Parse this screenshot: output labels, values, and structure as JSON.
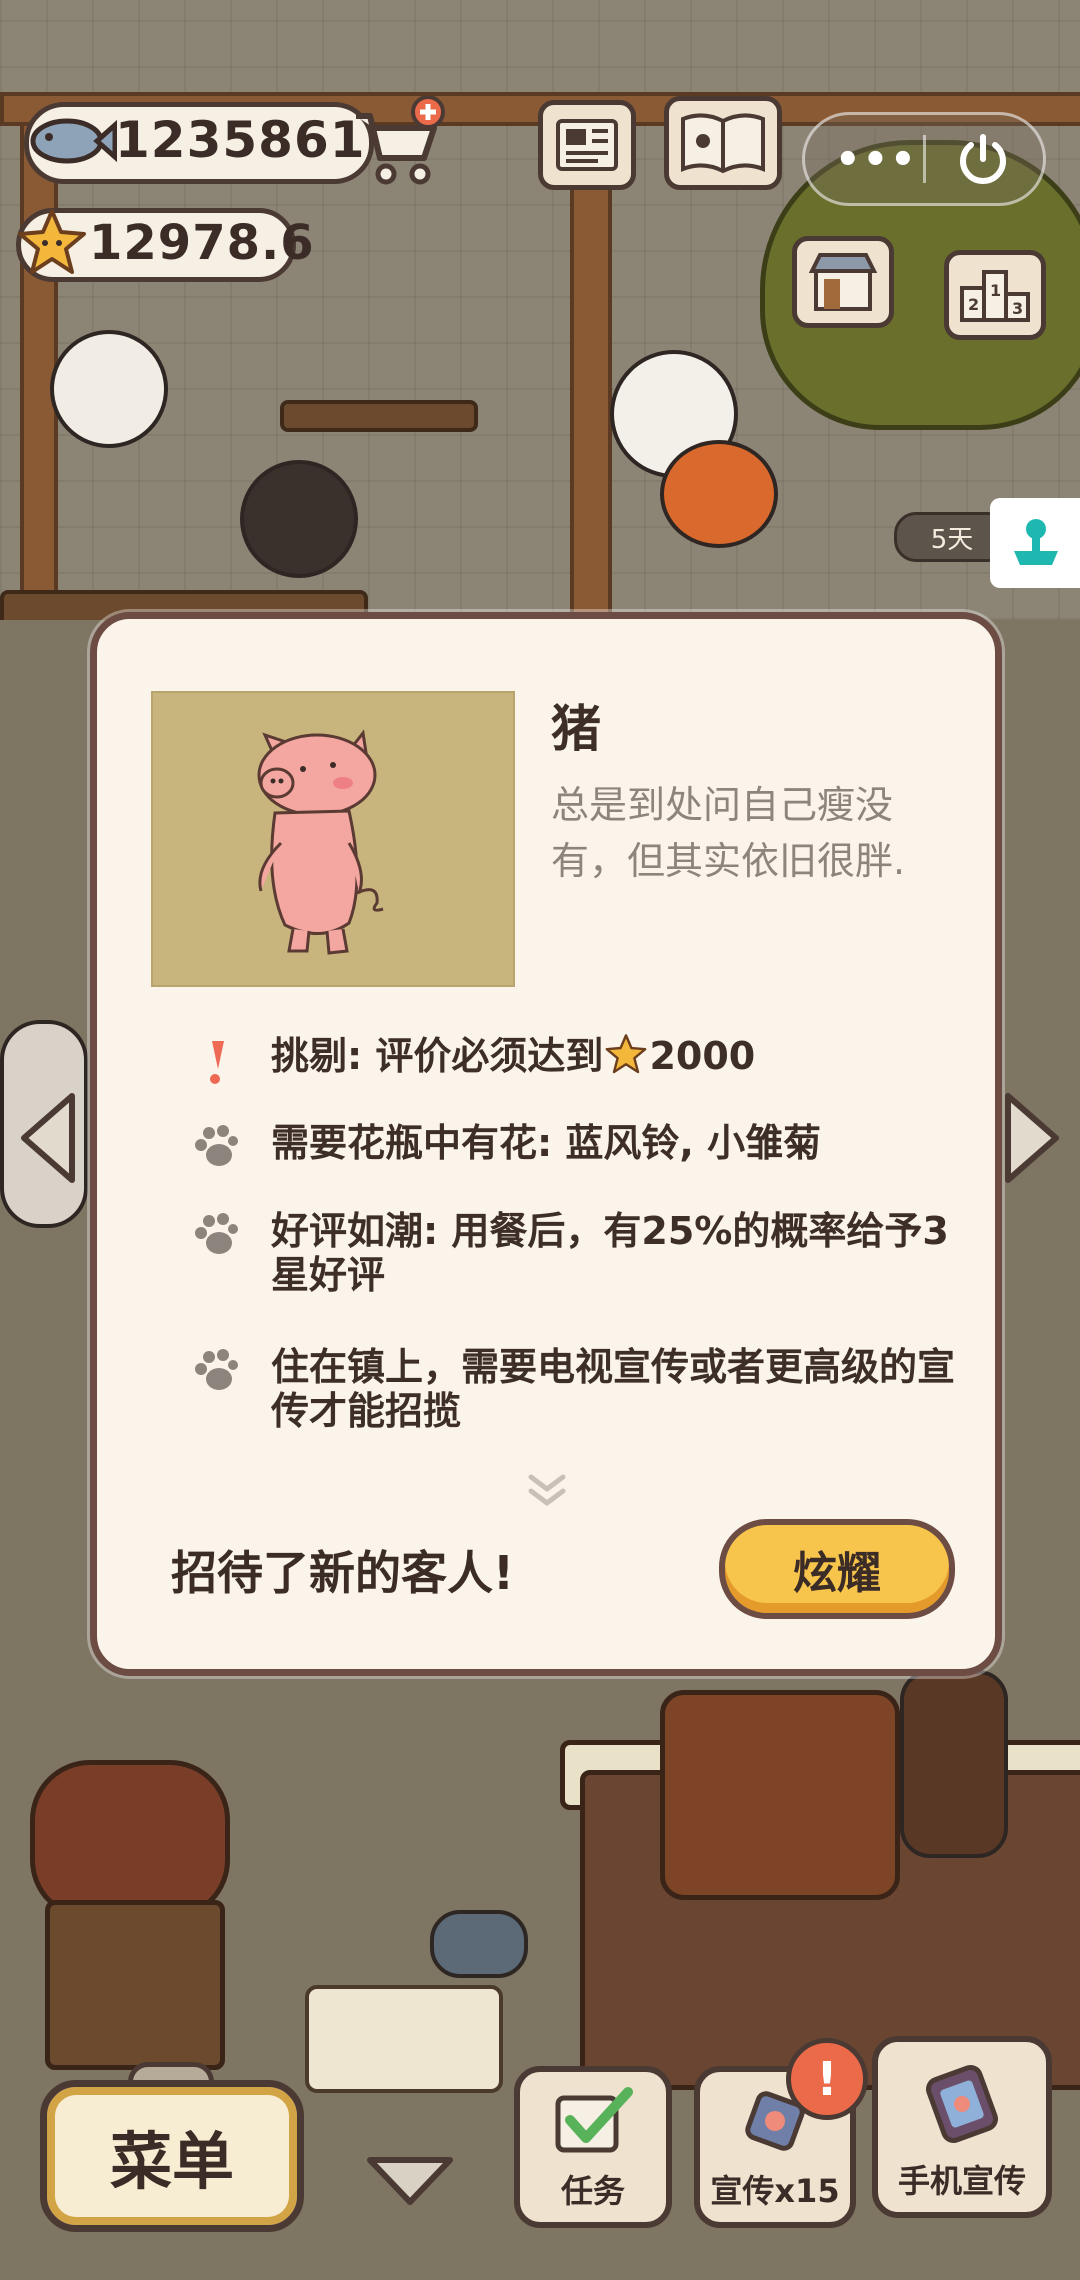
{
  "hud": {
    "fish_count": "1235861",
    "rating": "12978.6",
    "side_badge": "5天"
  },
  "dialog": {
    "customer_name": "猪",
    "customer_desc": "总是到处问自己瘦没有，但其实依旧很胖.",
    "traits": [
      {
        "icon": "exclamation-icon",
        "text_before": "挑剔: 评价必须达到",
        "star": true,
        "text_after": "2000"
      },
      {
        "icon": "paw-icon",
        "text": "需要花瓶中有花: 蓝风铃, 小雏菊"
      },
      {
        "icon": "paw-icon",
        "text": "好评如潮: 用餐后，有25%的概率给予3星好评"
      },
      {
        "icon": "paw-icon",
        "text": "住在镇上，需要电视宣传或者更高级的宣传才能招揽"
      }
    ],
    "welcome_text": "招待了新的客人!",
    "show_button": "炫耀"
  },
  "bottom": {
    "menu_label": "菜单",
    "task_label": "任务",
    "promo_label": "宣传x15",
    "phone_promo_label": "手机宣传",
    "alert_mark": "!"
  },
  "colors": {
    "accent_yellow": "#f8c54c",
    "dialog_bg": "#fbf4ea",
    "border_brown": "#6d4c43",
    "alert_red": "#ea6a4a"
  }
}
